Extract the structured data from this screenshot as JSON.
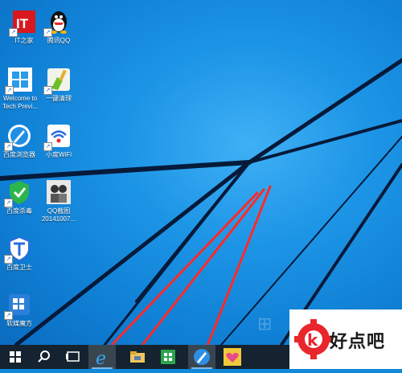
{
  "desktop_icons": [
    {
      "id": "ithome",
      "label": "IT之家",
      "icon": "ithome-logo-icon"
    },
    {
      "id": "qq",
      "label": "腾讯QQ",
      "icon": "qq-penguin-icon"
    },
    {
      "id": "welcome",
      "label": "Welcome to\nTech Previ...",
      "icon": "windows-logo-icon"
    },
    {
      "id": "cleanup",
      "label": "一键清理",
      "icon": "broom-cleanup-icon"
    },
    {
      "id": "baidu-browser",
      "label": "百度浏览器",
      "icon": "baidu-browser-icon"
    },
    {
      "id": "baidu-wifi",
      "label": "小度WiFi",
      "icon": "wifi-icon"
    },
    {
      "id": "baidu-antivirus",
      "label": "百度杀毒",
      "icon": "shield-check-icon"
    },
    {
      "id": "qq-screenshot",
      "label": "QQ截图\n20141007...",
      "icon": "photo-thumbnail-icon"
    },
    {
      "id": "baidu-guard",
      "label": "百度卫士",
      "icon": "guard-shield-icon"
    },
    {
      "id": "ruanmei",
      "label": "软媒魔方",
      "icon": "cube-icon"
    }
  ],
  "taskbar": {
    "items": [
      {
        "id": "start",
        "icon": "windows-start-icon"
      },
      {
        "id": "search",
        "icon": "search-icon"
      },
      {
        "id": "task-view",
        "icon": "task-view-icon"
      },
      {
        "id": "ie",
        "icon": "internet-explorer-icon"
      },
      {
        "id": "explorer",
        "icon": "file-explorer-icon"
      },
      {
        "id": "store",
        "icon": "windows-store-icon"
      },
      {
        "id": "baidu-browser",
        "icon": "baidu-browser-icon"
      },
      {
        "id": "photos",
        "icon": "heart-photos-icon"
      }
    ]
  },
  "watermark": {
    "text": "好点吧",
    "logo_icon": "gear-k-logo-icon",
    "colors": {
      "accent": "#e8262c",
      "text": "#1a1a1a"
    }
  },
  "annotation_arrows": {
    "color": "#ff2a2a",
    "count": 3
  },
  "colors": {
    "desktop": "#1a8fe0",
    "taskbar": "#14232f"
  }
}
